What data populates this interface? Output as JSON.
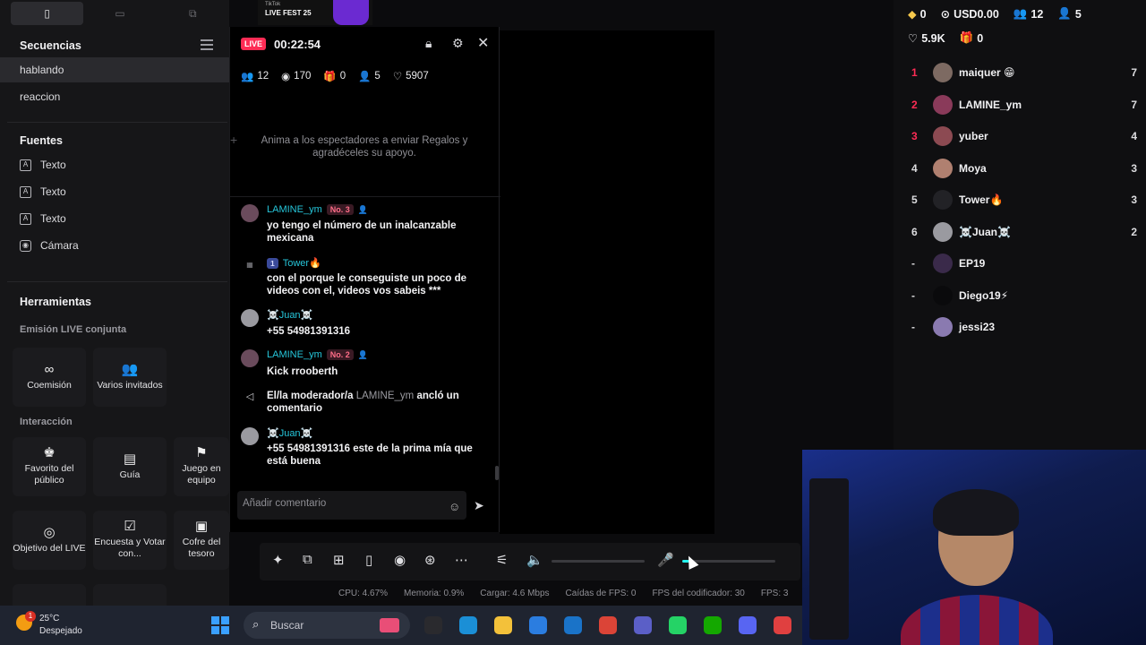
{
  "sidebar": {
    "view_toggle": {
      "icons": [
        "phone-portrait-icon",
        "landscape-icon",
        "multi-screen-icon"
      ],
      "glyphs": [
        "▯",
        "▭",
        "⧉"
      ]
    },
    "sequences_title": "Secuencias",
    "sequences": [
      "hablando",
      "reaccion"
    ],
    "sources_title": "Fuentes",
    "sources": [
      {
        "label": "Texto",
        "icon": "text-icon",
        "glyph": "A"
      },
      {
        "label": "Texto",
        "icon": "text-icon",
        "glyph": "A"
      },
      {
        "label": "Texto",
        "icon": "text-icon",
        "glyph": "A"
      },
      {
        "label": "Cámara",
        "icon": "camera-icon",
        "glyph": "◉"
      }
    ],
    "tools_title": "Herramientas",
    "joint_title": "Emisión LIVE conjunta",
    "joint_tools": [
      {
        "label": "Coemisión",
        "icon": "link-icon",
        "glyph": "∞"
      },
      {
        "label": "Varios invitados",
        "icon": "guests-icon",
        "glyph": "👥"
      }
    ],
    "interaction_title": "Interacción",
    "interaction_tools": [
      {
        "label": "Favorito del público",
        "icon": "favorite-audience-icon",
        "glyph": "♚"
      },
      {
        "label": "Guía",
        "icon": "guide-icon",
        "glyph": "▤"
      },
      {
        "label": "Juego en equipo",
        "icon": "team-game-icon",
        "glyph": "⚑"
      },
      {
        "label": "Objetivo del LIVE",
        "icon": "goal-icon",
        "glyph": "◎"
      },
      {
        "label": "Encuesta y Votar con...",
        "icon": "poll-icon",
        "glyph": "☑"
      },
      {
        "label": "Cofre del tesoro",
        "icon": "treasure-chest-icon",
        "glyph": "▣"
      }
    ]
  },
  "live": {
    "badge": "LIVE",
    "timer": "00:22:54",
    "stats": [
      {
        "icon": "viewers-icon",
        "glyph": "👥",
        "value": "12"
      },
      {
        "icon": "eye-icon",
        "glyph": "◉",
        "value": "170"
      },
      {
        "icon": "gift-icon",
        "glyph": "🎁",
        "value": "0"
      },
      {
        "icon": "new-followers-icon",
        "glyph": "👤",
        "value": "5"
      },
      {
        "icon": "heart-icon",
        "glyph": "♡",
        "value": "5907"
      }
    ],
    "prompt": "Anima a los espectadores a enviar Regalos y agradéceles su apoyo.",
    "messages": [
      {
        "name": "LAMINE_ym",
        "badge": "No. 3",
        "text": "yo tengo el número de un inalcanzable mexicana"
      },
      {
        "name": "Tower🔥",
        "level": "1",
        "text": "con el porque le conseguiste un poco de videos con el, videos vos sabeis ***"
      },
      {
        "name": "☠️Juan☠️",
        "text": "+55 54981391316"
      },
      {
        "name": "LAMINE_ym",
        "badge": "No. 2",
        "text": "Kick rrooberth"
      },
      {
        "system_pre": "El/la moderador/a ",
        "system_name": "LAMINE_ym",
        "system_post": " ancló un comentario"
      },
      {
        "name": "☠️Juan☠️",
        "text": "+55 54981391316 este de la prima mía que está buena"
      }
    ],
    "comment_placeholder": "Añadir comentario"
  },
  "fest": {
    "line1": "TikTok",
    "line2": "LIVE FEST 25"
  },
  "controls": {
    "icons": [
      "magic-wand-icon",
      "screen-share-icon",
      "add-scene-icon",
      "phone-icon",
      "record-icon",
      "camera-settings-icon",
      "more-icon",
      "mixer-icon",
      "speaker-icon",
      "microphone-icon"
    ],
    "glyphs": [
      "✦",
      "⧉",
      "⊞",
      "▯",
      "◉",
      "⊛",
      "⋯",
      "⚟",
      "🔈",
      "🎤"
    ],
    "volume_level": 0,
    "mic_level": 0.08
  },
  "status": {
    "cpu": "CPU: 4.67%",
    "memory": "Memoria: 0.9%",
    "upload": "Cargar: 4.6 Mbps",
    "fps_drops": "Caídas de FPS: 0",
    "encoder_fps": "FPS del codificador: 30",
    "fps": "FPS: 3"
  },
  "summary": {
    "diamonds": "0",
    "usd": "USD0.00",
    "viewers": "12",
    "followers": "5",
    "likes": "5.9K",
    "gifts": "0"
  },
  "leaderboard": [
    {
      "rank": "1",
      "name": "maiquer 😁",
      "score": "7",
      "rank_color": "#fe2c55",
      "avatar_color": "#7d6a62"
    },
    {
      "rank": "2",
      "name": "LAMINE_ym",
      "score": "7",
      "rank_color": "#fe2c55",
      "avatar_color": "#8a3a5a"
    },
    {
      "rank": "3",
      "name": "yuber",
      "score": "4",
      "rank_color": "#fe2c55",
      "avatar_color": "#8c4a52"
    },
    {
      "rank": "4",
      "name": "Moya",
      "score": "3",
      "rank_color": "#dcdcdf",
      "avatar_color": "#b08070"
    },
    {
      "rank": "5",
      "name": "Tower🔥",
      "score": "3",
      "rank_color": "#dcdcdf",
      "avatar_color": "#222226"
    },
    {
      "rank": "6",
      "name": "☠️Juan☠️",
      "score": "2",
      "rank_color": "#dcdcdf",
      "avatar_color": "#9a9aa0"
    },
    {
      "rank": "-",
      "name": "EP19",
      "score": "",
      "rank_color": "#dcdcdf",
      "avatar_color": "#3a2a4a"
    },
    {
      "rank": "-",
      "name": "Diego19⚡",
      "score": "",
      "rank_color": "#dcdcdf",
      "avatar_color": "#0a0a0c"
    },
    {
      "rank": "-",
      "name": "jessi23",
      "score": "",
      "rank_color": "#dcdcdf",
      "avatar_color": "#8a7ab0"
    }
  ],
  "taskbar": {
    "notification_count": "1",
    "temperature": "25°C",
    "weather": "Despejado",
    "search_placeholder": "Buscar",
    "apps": [
      {
        "icon": "file-explorer-app-icon",
        "color": "#2a2a2e"
      },
      {
        "icon": "edge-app-icon",
        "color": "#1b8fd6"
      },
      {
        "icon": "folder-app-icon",
        "color": "#f3c13a"
      },
      {
        "icon": "store-app-icon",
        "color": "#2b7de0"
      },
      {
        "icon": "outlook-app-icon",
        "color": "#1a73c8"
      },
      {
        "icon": "chrome-app-icon",
        "color": "#db4437"
      },
      {
        "icon": "teams-app-icon",
        "color": "#5b5fc7"
      },
      {
        "icon": "whatsapp-app-icon",
        "color": "#25d366"
      },
      {
        "icon": "upwork-app-icon",
        "color": "#14a800"
      },
      {
        "icon": "discord-app-icon",
        "color": "#5865f2"
      },
      {
        "icon": "chrome-profile-app-icon",
        "color": "#e04040"
      }
    ]
  }
}
